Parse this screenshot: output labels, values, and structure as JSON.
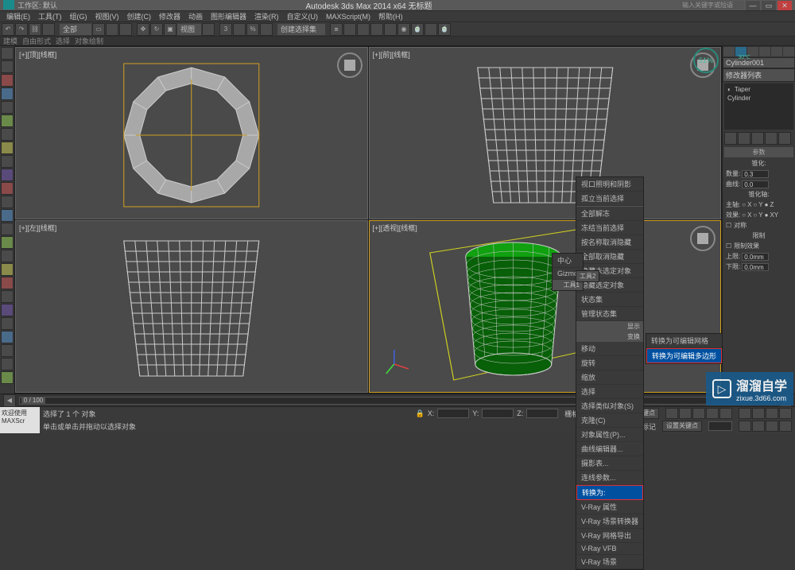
{
  "titlebar": {
    "workspace": "工作区: 默认",
    "app_title": "Autodesk 3ds Max 2014 x64   无标题",
    "search_placeholder": "输入关键字或短语"
  },
  "menu": {
    "items": [
      "编辑(E)",
      "工具(T)",
      "组(G)",
      "视图(V)",
      "创建(C)",
      "修改器",
      "动画",
      "图形编辑器",
      "渲染(R)",
      "自定义(U)",
      "MAXScript(M)",
      "帮助(H)"
    ]
  },
  "toolbar": {
    "dropdown1": "全部",
    "dropdown2": "创建选择集"
  },
  "tabs": [
    "建模",
    "自由形式",
    "选择",
    "对象绘制"
  ],
  "viewports": {
    "top": "[+][顶][线框]",
    "front": "[+][前][线框]",
    "left": "[+][左][线框]",
    "persp": "[+][透视][线框]"
  },
  "cpu": {
    "value": "51%",
    "label": "CPU温度",
    "temp": "30℃"
  },
  "right_panel": {
    "object_name": "Cylinder001",
    "modifier_title": "修改器列表",
    "stack": [
      {
        "icon": "◐",
        "name": "Taper"
      },
      {
        "icon": "",
        "name": "Cylinder"
      }
    ],
    "rollouts": {
      "params": "参数",
      "taper": "锥化:",
      "qty_label": "数量:",
      "qty_val": "0.3",
      "curve_label": "曲线:",
      "curve_val": "0.0",
      "axis": "锥化轴:",
      "main_axis": "主轴:",
      "axes": [
        "X",
        "Y",
        "Z"
      ],
      "effect": "效果:",
      "effects": [
        "X",
        "Y",
        "XY"
      ],
      "symmetric": "对称",
      "limit": "限制",
      "limit_effect": "限制效果",
      "upper": "上限:",
      "upper_val": "0.0mm",
      "lower": "下限:",
      "lower_val": "0.0mm"
    }
  },
  "context_menu": {
    "section1": [
      "视口照明和阴影",
      "孤立当前选择"
    ],
    "section2": [
      "全部解冻",
      "冻结当前选择",
      "按名称取消隐藏",
      "全部取消隐藏",
      "隐藏未选定对象",
      "隐藏选定对象",
      "状态集",
      "管理状态集"
    ],
    "header1": "显示",
    "header2": "变换",
    "section3": [
      "移动",
      "旋转",
      "缩放",
      "选择",
      "选择类似对象(S)",
      "克隆(C)",
      "对象属性(P)...",
      "曲线编辑器...",
      "摄影表...",
      "连线参数..."
    ],
    "convert": "转换为:",
    "vray": [
      "V-Ray 属性",
      "V-Ray 场景转换器",
      "V-Ray 网格导出",
      "V-Ray VFB",
      "V-Ray 场景"
    ],
    "submenu_header": "工具2",
    "submenu": [
      "转换为可编辑网格",
      "转换为可编辑多边形"
    ]
  },
  "timeline": {
    "frame": "0 / 100"
  },
  "statusbar": {
    "welcome": "欢迎使用",
    "maxscr": "MAXScr",
    "sel": "选择了 1 个 对象",
    "hint": "单击或单击并拖动以选择对象",
    "grid": "栅格 = 10.0mm",
    "autokey": "自动关键点",
    "setkey": "设置关键点",
    "add_time": "添加时间标记"
  },
  "watermark": {
    "brand": "溜溜自学",
    "url": "zixue.3d66.com"
  }
}
